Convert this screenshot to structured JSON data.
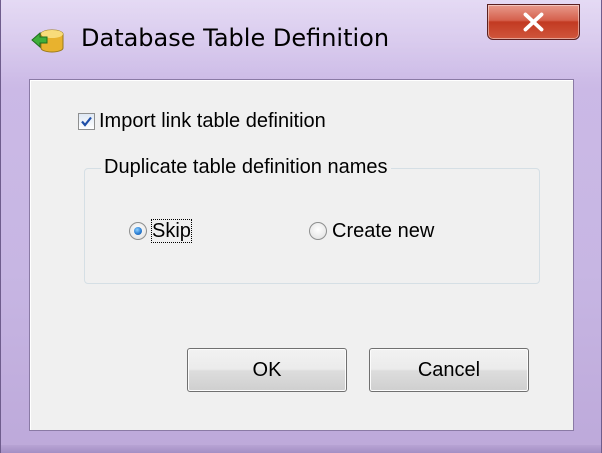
{
  "window": {
    "title": "Database Table Definition"
  },
  "titlebar": {
    "icon": "database-arrow-icon",
    "close_icon": "close-icon"
  },
  "import_link": {
    "label": "Import link table definition",
    "checked": true
  },
  "duplicates_group": {
    "legend": "Duplicate table definition names",
    "options": [
      {
        "label": "Skip",
        "selected": true
      },
      {
        "label": "Create new",
        "selected": false
      }
    ]
  },
  "buttons": {
    "ok_label": "OK",
    "cancel_label": "Cancel"
  },
  "colors": {
    "frame": "#c7b6e3",
    "close_button": "#c23a22",
    "dialog_background": "#f0f0f0",
    "radio_selected": "#2c7fd4",
    "checkbox_check": "#1f4fa8"
  }
}
